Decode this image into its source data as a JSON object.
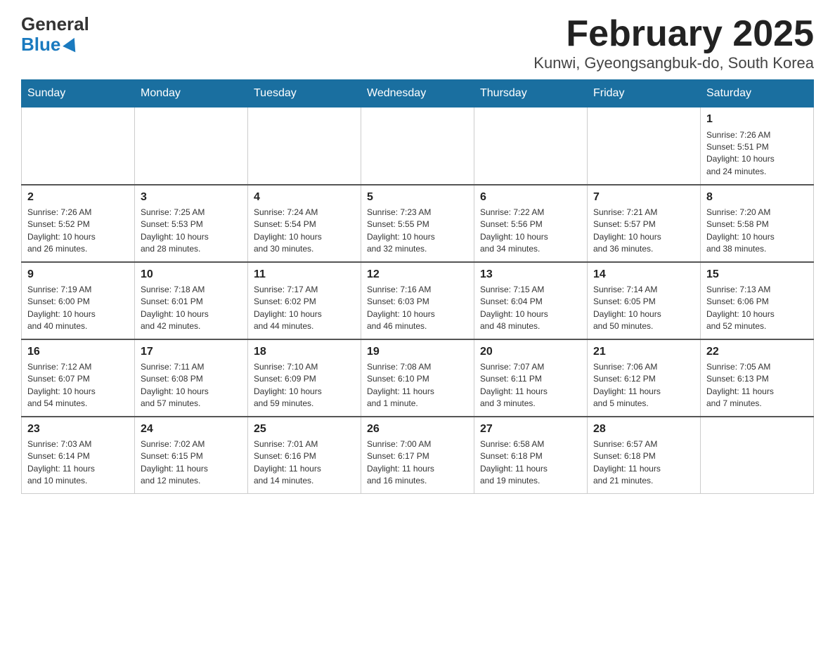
{
  "logo": {
    "general": "General",
    "blue": "Blue"
  },
  "title": "February 2025",
  "subtitle": "Kunwi, Gyeongsangbuk-do, South Korea",
  "days_of_week": [
    "Sunday",
    "Monday",
    "Tuesday",
    "Wednesday",
    "Thursday",
    "Friday",
    "Saturday"
  ],
  "weeks": [
    [
      {
        "day": "",
        "info": ""
      },
      {
        "day": "",
        "info": ""
      },
      {
        "day": "",
        "info": ""
      },
      {
        "day": "",
        "info": ""
      },
      {
        "day": "",
        "info": ""
      },
      {
        "day": "",
        "info": ""
      },
      {
        "day": "1",
        "info": "Sunrise: 7:26 AM\nSunset: 5:51 PM\nDaylight: 10 hours\nand 24 minutes."
      }
    ],
    [
      {
        "day": "2",
        "info": "Sunrise: 7:26 AM\nSunset: 5:52 PM\nDaylight: 10 hours\nand 26 minutes."
      },
      {
        "day": "3",
        "info": "Sunrise: 7:25 AM\nSunset: 5:53 PM\nDaylight: 10 hours\nand 28 minutes."
      },
      {
        "day": "4",
        "info": "Sunrise: 7:24 AM\nSunset: 5:54 PM\nDaylight: 10 hours\nand 30 minutes."
      },
      {
        "day": "5",
        "info": "Sunrise: 7:23 AM\nSunset: 5:55 PM\nDaylight: 10 hours\nand 32 minutes."
      },
      {
        "day": "6",
        "info": "Sunrise: 7:22 AM\nSunset: 5:56 PM\nDaylight: 10 hours\nand 34 minutes."
      },
      {
        "day": "7",
        "info": "Sunrise: 7:21 AM\nSunset: 5:57 PM\nDaylight: 10 hours\nand 36 minutes."
      },
      {
        "day": "8",
        "info": "Sunrise: 7:20 AM\nSunset: 5:58 PM\nDaylight: 10 hours\nand 38 minutes."
      }
    ],
    [
      {
        "day": "9",
        "info": "Sunrise: 7:19 AM\nSunset: 6:00 PM\nDaylight: 10 hours\nand 40 minutes."
      },
      {
        "day": "10",
        "info": "Sunrise: 7:18 AM\nSunset: 6:01 PM\nDaylight: 10 hours\nand 42 minutes."
      },
      {
        "day": "11",
        "info": "Sunrise: 7:17 AM\nSunset: 6:02 PM\nDaylight: 10 hours\nand 44 minutes."
      },
      {
        "day": "12",
        "info": "Sunrise: 7:16 AM\nSunset: 6:03 PM\nDaylight: 10 hours\nand 46 minutes."
      },
      {
        "day": "13",
        "info": "Sunrise: 7:15 AM\nSunset: 6:04 PM\nDaylight: 10 hours\nand 48 minutes."
      },
      {
        "day": "14",
        "info": "Sunrise: 7:14 AM\nSunset: 6:05 PM\nDaylight: 10 hours\nand 50 minutes."
      },
      {
        "day": "15",
        "info": "Sunrise: 7:13 AM\nSunset: 6:06 PM\nDaylight: 10 hours\nand 52 minutes."
      }
    ],
    [
      {
        "day": "16",
        "info": "Sunrise: 7:12 AM\nSunset: 6:07 PM\nDaylight: 10 hours\nand 54 minutes."
      },
      {
        "day": "17",
        "info": "Sunrise: 7:11 AM\nSunset: 6:08 PM\nDaylight: 10 hours\nand 57 minutes."
      },
      {
        "day": "18",
        "info": "Sunrise: 7:10 AM\nSunset: 6:09 PM\nDaylight: 10 hours\nand 59 minutes."
      },
      {
        "day": "19",
        "info": "Sunrise: 7:08 AM\nSunset: 6:10 PM\nDaylight: 11 hours\nand 1 minute."
      },
      {
        "day": "20",
        "info": "Sunrise: 7:07 AM\nSunset: 6:11 PM\nDaylight: 11 hours\nand 3 minutes."
      },
      {
        "day": "21",
        "info": "Sunrise: 7:06 AM\nSunset: 6:12 PM\nDaylight: 11 hours\nand 5 minutes."
      },
      {
        "day": "22",
        "info": "Sunrise: 7:05 AM\nSunset: 6:13 PM\nDaylight: 11 hours\nand 7 minutes."
      }
    ],
    [
      {
        "day": "23",
        "info": "Sunrise: 7:03 AM\nSunset: 6:14 PM\nDaylight: 11 hours\nand 10 minutes."
      },
      {
        "day": "24",
        "info": "Sunrise: 7:02 AM\nSunset: 6:15 PM\nDaylight: 11 hours\nand 12 minutes."
      },
      {
        "day": "25",
        "info": "Sunrise: 7:01 AM\nSunset: 6:16 PM\nDaylight: 11 hours\nand 14 minutes."
      },
      {
        "day": "26",
        "info": "Sunrise: 7:00 AM\nSunset: 6:17 PM\nDaylight: 11 hours\nand 16 minutes."
      },
      {
        "day": "27",
        "info": "Sunrise: 6:58 AM\nSunset: 6:18 PM\nDaylight: 11 hours\nand 19 minutes."
      },
      {
        "day": "28",
        "info": "Sunrise: 6:57 AM\nSunset: 6:18 PM\nDaylight: 11 hours\nand 21 minutes."
      },
      {
        "day": "",
        "info": ""
      }
    ]
  ]
}
